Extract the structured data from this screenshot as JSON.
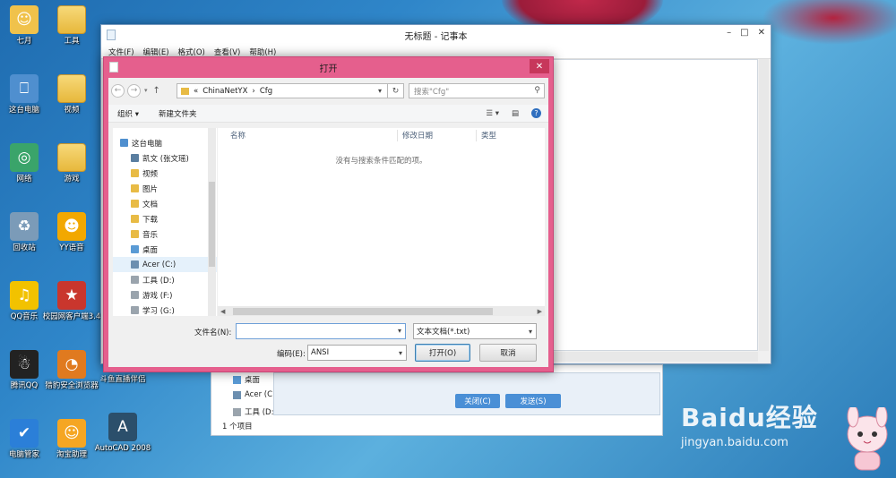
{
  "desktop": {
    "icons": [
      {
        "label": "七月",
        "glyph": "☺",
        "icon": "user-folder-icon",
        "color": "#f0c24b"
      },
      {
        "label": "这台电脑",
        "glyph": "⎕",
        "icon": "computer-icon",
        "color": "#4f8fcf"
      },
      {
        "label": "网络",
        "glyph": "◎",
        "icon": "network-icon",
        "color": "#3aa46a"
      },
      {
        "label": "回收站",
        "glyph": "♻",
        "icon": "recycle-bin-icon",
        "color": "#7b9bb8"
      },
      {
        "label": "QQ音乐",
        "glyph": "♫",
        "icon": "qq-music-icon",
        "color": "#f2c200"
      },
      {
        "label": "腾讯QQ",
        "glyph": "☃",
        "icon": "qq-icon",
        "color": "#222222"
      },
      {
        "label": "电脑管家",
        "glyph": "✔",
        "icon": "pc-manager-icon",
        "color": "#2b7fd8"
      }
    ],
    "icons_col2": [
      {
        "label": "工具",
        "glyph": "",
        "icon": "folder-icon",
        "color": "#f0c24b"
      },
      {
        "label": "视频",
        "glyph": "",
        "icon": "folder-icon",
        "color": "#f0c24b"
      },
      {
        "label": "游戏",
        "glyph": "",
        "icon": "folder-icon",
        "color": "#f0c24b"
      },
      {
        "label": "YY语音",
        "glyph": "☻",
        "icon": "yy-voice-icon",
        "color": "#f2a800"
      },
      {
        "label": "校园网客户端3.4",
        "glyph": "★",
        "icon": "campus-network-icon",
        "color": "#c9362d"
      },
      {
        "label": "猎豹安全浏览器",
        "glyph": "◔",
        "icon": "cheetah-browser-icon",
        "color": "#e07a1f"
      },
      {
        "label": "淘宝助理",
        "glyph": "☺",
        "icon": "taobao-assistant-icon",
        "color": "#f5a623"
      }
    ],
    "icons_col3": [
      {
        "label": "斗鱼直播伴侣",
        "glyph": "▶",
        "icon": "douyu-icon",
        "color": "#f07a1a"
      },
      {
        "label": "AutoCAD 2008",
        "glyph": "A",
        "icon": "autocad-icon",
        "color": "#2b4f6b"
      }
    ]
  },
  "notepad": {
    "title": "无标题 - 记事本",
    "menu": [
      "文件(F)",
      "编辑(E)",
      "格式(O)",
      "查看(V)",
      "帮助(H)"
    ],
    "controls": {
      "minimize": "–",
      "maximize": "□",
      "close": "✕"
    }
  },
  "explorer_bg": {
    "items": [
      "桌面",
      "Acer (C:)",
      "工具 (D:)"
    ],
    "status": "1 个项目"
  },
  "notify": {
    "close_label": "关闭(C)",
    "send_label": "发送(S)"
  },
  "dialog": {
    "title": "打开",
    "close": "✕",
    "address": {
      "prefix": "«",
      "parts": [
        "ChinaNetYX",
        "›",
        "Cfg"
      ]
    },
    "search": {
      "placeholder": "搜索\"Cfg\""
    },
    "toolbar": {
      "organize": "组织 ▾",
      "new_folder": "新建文件夹"
    },
    "nav": [
      {
        "label": "这台电脑",
        "color": "#4f8fcf"
      },
      {
        "label": "凯文 (张文瑶)",
        "color": "#5a7ea0"
      },
      {
        "label": "视频",
        "color": "#e8bb45"
      },
      {
        "label": "图片",
        "color": "#e8bb45"
      },
      {
        "label": "文档",
        "color": "#e8bb45"
      },
      {
        "label": "下载",
        "color": "#e8bb45"
      },
      {
        "label": "音乐",
        "color": "#e8bb45"
      },
      {
        "label": "桌面",
        "color": "#5a9bd5"
      },
      {
        "label": "Acer (C:)",
        "color": "#6c8fb0"
      },
      {
        "label": "工具 (D:)",
        "color": "#9aa4ad"
      },
      {
        "label": "游戏 (F:)",
        "color": "#9aa4ad"
      },
      {
        "label": "学习 (G:)",
        "color": "#9aa4ad"
      }
    ],
    "columns": [
      "名称",
      "修改日期",
      "类型"
    ],
    "empty_message": "没有与搜索条件匹配的项。",
    "filename_label": "文件名(N):",
    "filename_value": "",
    "filetype_value": "文本文档(*.txt)",
    "encoding_label": "编码(E):",
    "encoding_value": "ANSI",
    "open_label": "打开(O)",
    "cancel_label": "取消"
  },
  "watermark": {
    "brand": "Baidu经验",
    "url": "jingyan.baidu.com"
  }
}
